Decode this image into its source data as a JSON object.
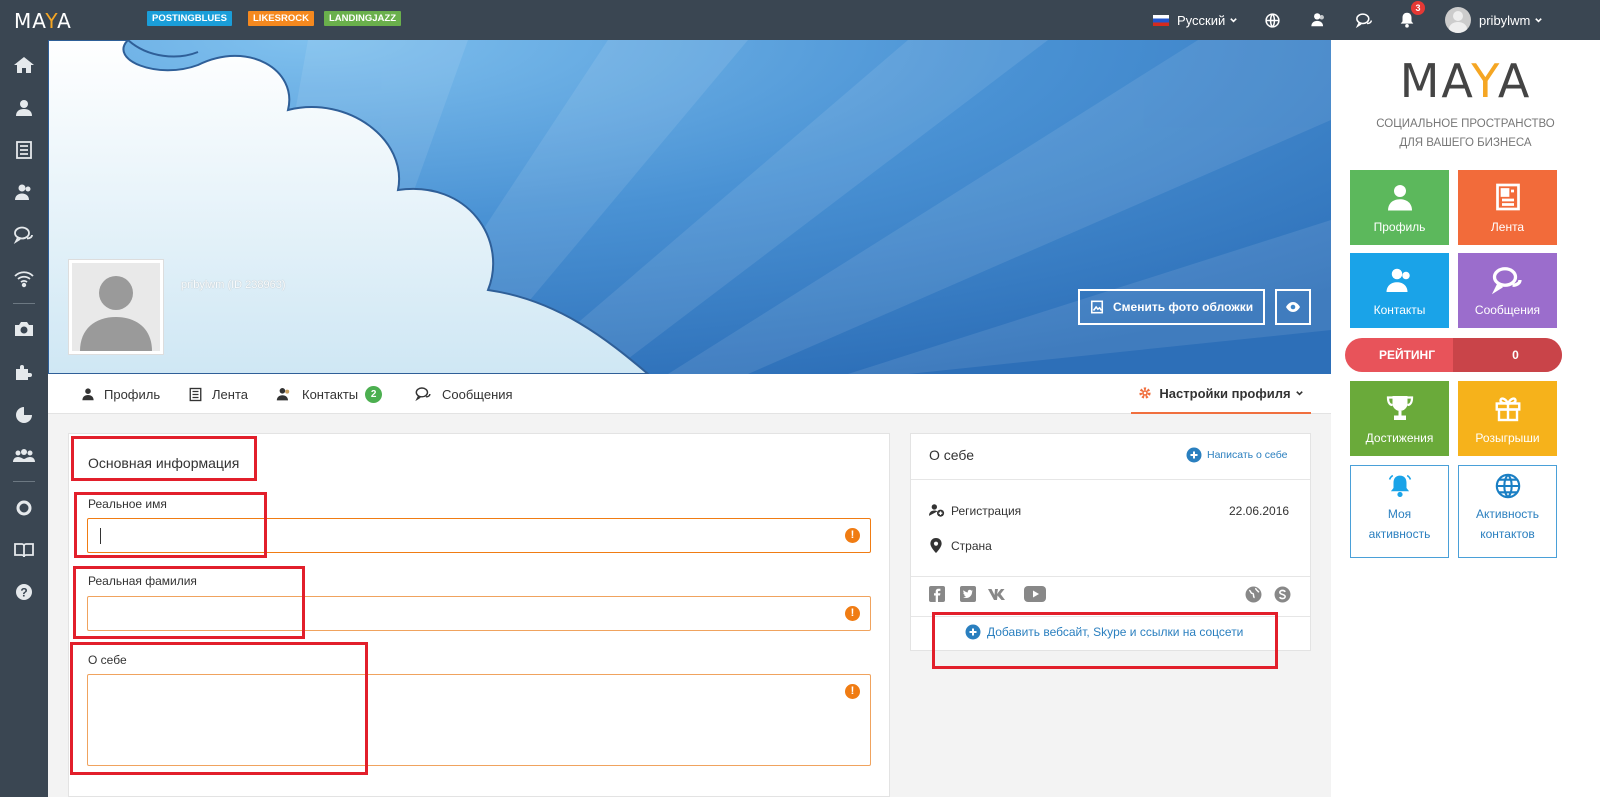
{
  "topbar": {
    "logo_left": "MA",
    "logo_y": "Y",
    "logo_right": "A",
    "chips": [
      {
        "label": "POSTINGBLUES",
        "color": "#1a9ed9"
      },
      {
        "label": "LIKESROCK",
        "color": "#f5891f"
      },
      {
        "label": "LANDINGJAZZ",
        "color": "#6ab04c"
      }
    ],
    "language": "Русский",
    "notifications_count": "3",
    "username": "pribylwm"
  },
  "sidebar": {
    "icons": [
      "home-icon",
      "user-icon",
      "feed-icon",
      "contacts-icon",
      "messages-icon",
      "wifi-icon",
      "camera-icon",
      "puzzle-icon",
      "pie-chart-icon",
      "group-icon",
      "lifebuoy-icon",
      "book-icon",
      "help-icon"
    ]
  },
  "cover": {
    "username_id": "pribylwm (ID 238963)",
    "change_cover_label": "Сменить фото обложки"
  },
  "tabs": {
    "profile": "Профиль",
    "feed": "Лента",
    "contacts": "Контакты",
    "contacts_badge": "2",
    "messages": "Сообщения",
    "settings": "Настройки профиля"
  },
  "basic_info": {
    "title": "Основная информация",
    "first_name_label": "Реальное имя",
    "first_name_value": "",
    "last_name_label": "Реальная фамилия",
    "last_name_value": "",
    "about_label": "О себе",
    "about_value": "",
    "warn_glyph": "!"
  },
  "about_panel": {
    "title": "О себе",
    "write_link": "Написать о себе",
    "registration_label": "Регистрация",
    "registration_date": "22.06.2016",
    "country_label": "Страна",
    "add_links_label": "Добавить вебсайт, Skype и ссылки на соцсети"
  },
  "right_panel": {
    "logo_left": "MA",
    "logo_y": "Y",
    "logo_right": "A",
    "tagline_1": "СОЦИАЛЬНОЕ ПРОСТРАНСТВО",
    "tagline_2": "ДЛЯ ВАШЕГО БИЗНЕСА",
    "tiles": [
      {
        "label": "Профиль",
        "color": "#5cb85c",
        "icon": "user-icon"
      },
      {
        "label": "Лента",
        "color": "#f26b3a",
        "icon": "feed-icon"
      },
      {
        "label": "Контакты",
        "color": "#1aa3e8",
        "icon": "contacts-icon"
      },
      {
        "label": "Сообщения",
        "color": "#9b6dcc",
        "icon": "messages-icon"
      },
      {
        "label": "Достижения",
        "color": "#6aaa3a",
        "icon": "trophy-icon"
      },
      {
        "label": "Розыгрыши",
        "color": "#f6b21b",
        "icon": "gift-icon"
      }
    ],
    "rating_label": "РЕЙТИНГ",
    "rating_value": "0",
    "activity_1_line1": "Моя",
    "activity_1_line2": "активность",
    "activity_2_line1": "Активность",
    "activity_2_line2": "контактов"
  }
}
